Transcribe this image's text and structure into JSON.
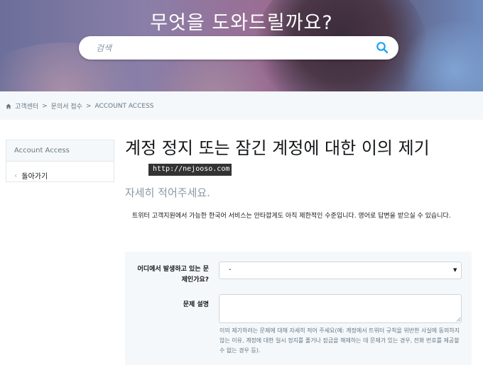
{
  "hero": {
    "title": "무엇을 도와드릴까요?",
    "search_placeholder": "검색"
  },
  "breadcrumb": {
    "home": "고객센터",
    "level2": "문의서 접수",
    "level3": "ACCOUNT ACCESS"
  },
  "sidebar": {
    "heading": "Account Access",
    "back_label": "돌아가기"
  },
  "main": {
    "title": "계정 정지 또는 잠긴 계정에 대한 이의 제기",
    "watermark": "http://nejooso.com",
    "subtitle": "자세히 적어주세요.",
    "notice": "트위터 고객지원에서 가능한 한국어 서비스는 안타깝게도 아직 제한적인 수준입니다. 영어로 답변을 받으실 수 있습니다."
  },
  "form": {
    "location_label": "어디에서 발생하고 있는 문제인가요?",
    "location_value": "-",
    "description_label": "문제 설명",
    "description_help": "이의 제기하려는 문제에 대해 자세히 적어 주세요(예: 계정에서 트위터 규칙을 위반한 사실에 동의하지 않는 이유, 계정에 대한 일시 정지를 풀거나 잠금을 해제하는 데 문제가 있는 경우, 전화 번호를 제공할 수 없는 경우 등)."
  },
  "colors": {
    "accent": "#1da1f2",
    "muted_text": "#657786",
    "panel_bg": "#f5f8fa"
  },
  "icons": {
    "search": "search-icon",
    "home": "home-icon",
    "back": "chevron-left-icon",
    "dropdown": "caret-down-icon"
  }
}
